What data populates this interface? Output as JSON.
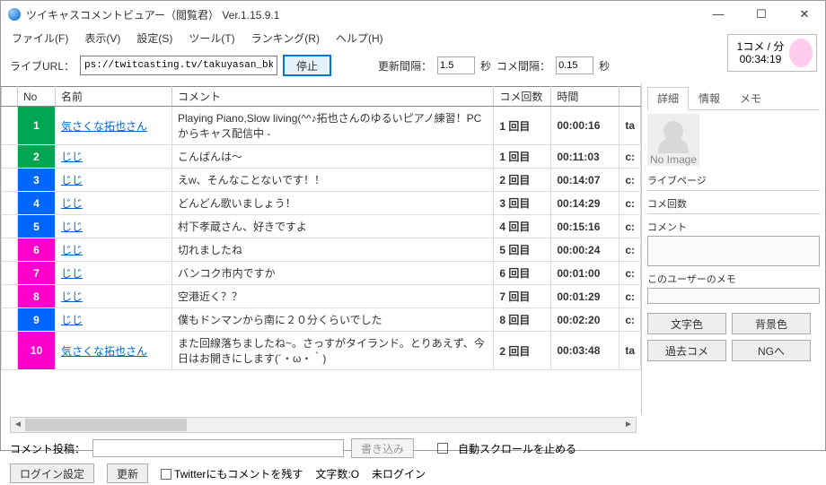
{
  "window": {
    "title": "ツイキャスコメントビュアー（閲覧君） Ver.1.15.9.1"
  },
  "menu": [
    "ファイル(F)",
    "表示(V)",
    "設定(S)",
    "ツール(T)",
    "ランキング(R)",
    "ヘルプ(H)"
  ],
  "toolbar": {
    "urlLabel": "ライブURL：",
    "url": "ps://twitcasting.tv/takuyasan_bkk/",
    "stop": "停止",
    "intervalLabel": "更新間隔：",
    "interval": "1.5",
    "sec1": "秒",
    "gapLabel": "コメ間隔：",
    "gap": "0.15",
    "sec2": "秒"
  },
  "meter": {
    "rate": "1コメ / 分",
    "time": "00:34:19"
  },
  "headers": {
    "no": "No",
    "name": "名前",
    "comment": "コメント",
    "count": "コメ回数",
    "time": "時間",
    "extra": ""
  },
  "rows": [
    {
      "no": "1",
      "bg": "#00a651",
      "name": "気さくな拓也さん",
      "comment": "Playing Piano,Slow living(^^♪拓也さんのゆるいピアノ練習！PCからキャス配信中 -",
      "count": "1 回目",
      "cclass": "green",
      "time": "00:00:16",
      "ex": "ta"
    },
    {
      "no": "2",
      "bg": "#00a651",
      "name": "じじ",
      "comment": "こんばんは～",
      "count": "1 回目",
      "cclass": "green",
      "time": "00:11:03",
      "ex": "c:"
    },
    {
      "no": "3",
      "bg": "#0066ff",
      "name": "じじ",
      "comment": "えw、そんなことないです！！",
      "count": "2 回目",
      "cclass": "blue",
      "time": "00:14:07",
      "ex": "c:"
    },
    {
      "no": "4",
      "bg": "#0066ff",
      "name": "じじ",
      "comment": "どんどん歌いましょう！",
      "count": "3 回目",
      "cclass": "blue",
      "time": "00:14:29",
      "ex": "c:"
    },
    {
      "no": "5",
      "bg": "#0066ff",
      "name": "じじ",
      "comment": "村下孝蔵さん、好きですよ",
      "count": "4 回目",
      "cclass": "blue",
      "time": "00:15:16",
      "ex": "c:"
    },
    {
      "no": "6",
      "bg": "#ff00cc",
      "name": "じじ",
      "comment": "切れましたね",
      "count": "5 回目",
      "cclass": "purple",
      "time": "00:00:24",
      "ex": "c:"
    },
    {
      "no": "7",
      "bg": "#ff00cc",
      "name": "じじ",
      "comment": "バンコク市内ですか",
      "count": "6 回目",
      "cclass": "red",
      "time": "00:01:00",
      "ex": "c:"
    },
    {
      "no": "8",
      "bg": "#ff00cc",
      "name": "じじ",
      "comment": "空港近く？？",
      "count": "7 回目",
      "cclass": "red",
      "time": "00:01:29",
      "ex": "c:"
    },
    {
      "no": "9",
      "bg": "#0066ff",
      "name": "じじ",
      "comment": "僕もドンマンから南に２０分くらいでした",
      "count": "8 回目",
      "cclass": "blue",
      "time": "00:02:20",
      "ex": "c:"
    },
    {
      "no": "10",
      "bg": "#ff00cc",
      "name": "気さくな拓也さん",
      "comment": "また回線落ちましたね~。さっすがタイランド。とりあえず、今日はお開きにします(´・ω・｀)",
      "count": "2 回目",
      "cclass": "blue",
      "time": "00:03:48",
      "ex": "ta"
    }
  ],
  "side": {
    "tabs": [
      "詳細",
      "情報",
      "メモ"
    ],
    "noimage": "No Image",
    "labels": {
      "page": "ライブページ",
      "count": "コメ回数",
      "comment": "コメント",
      "memo": "このユーザーのメモ"
    },
    "btns": [
      "文字色",
      "背景色",
      "過去コメ",
      "NGへ"
    ]
  },
  "bottom": {
    "postLabel": "コメント投稿：",
    "post": "書き込み",
    "autoscroll": "自動スクロールを止める",
    "login": "ログイン設定",
    "refresh": "更新",
    "twitter": "Twitterにもコメントを残す",
    "chars": "文字数:O",
    "status": "未ログイン"
  }
}
